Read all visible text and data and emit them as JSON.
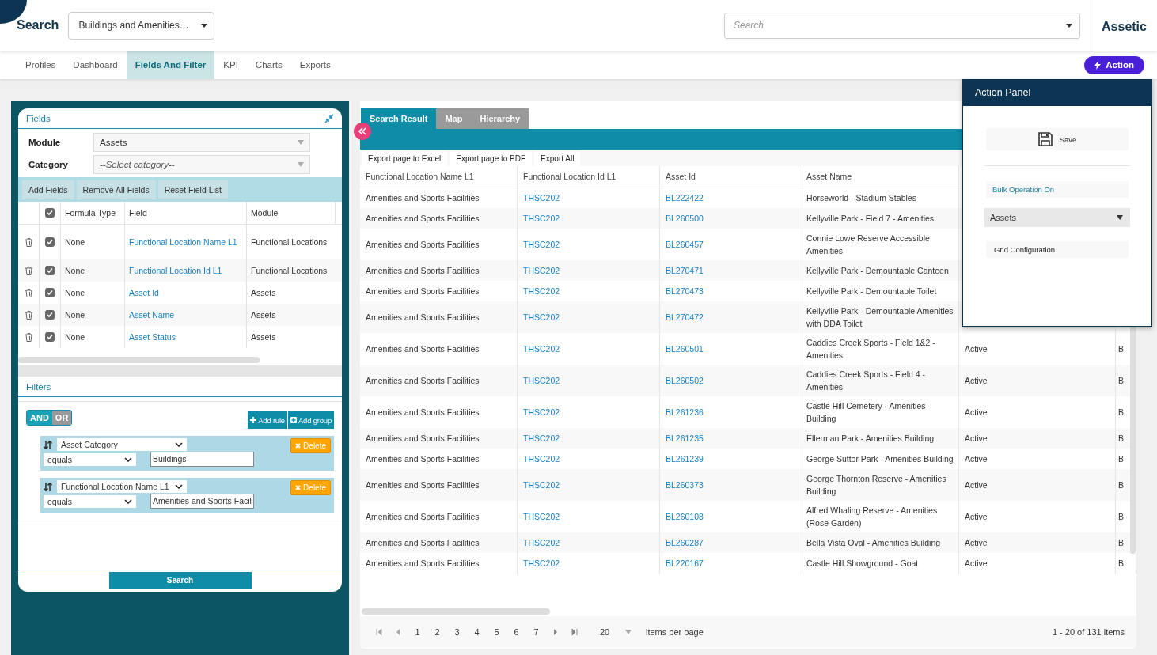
{
  "header": {
    "title": "Search",
    "profile_select": "Buildings and Amenities…",
    "search": {
      "placeholder": "Search"
    },
    "logo": "Assetic"
  },
  "nav_tabs": [
    {
      "label": "Profiles",
      "selected": false
    },
    {
      "label": "Dashboard",
      "selected": false
    },
    {
      "label": "Fields And Filter",
      "selected": true
    },
    {
      "label": "KPI",
      "selected": false
    },
    {
      "label": "Charts",
      "selected": false
    },
    {
      "label": "Exports",
      "selected": false
    }
  ],
  "action_button": "Action",
  "fields_panel": {
    "title": "Fields",
    "module_label": "Module",
    "module_value": "Assets",
    "category_label": "Category",
    "category_placeholder": "--Select category--",
    "buttons": [
      "Add Fields",
      "Remove All Fields",
      "Reset Field List"
    ],
    "columns": [
      "Formula Type",
      "Field",
      "Module"
    ],
    "header_checked": true,
    "rows": [
      {
        "checked": true,
        "formula": "None",
        "field": "Functional Location Name L1",
        "module": "Functional Locations"
      },
      {
        "checked": true,
        "formula": "None",
        "field": "Functional Location Id L1",
        "module": "Functional Locations"
      },
      {
        "checked": true,
        "formula": "None",
        "field": "Asset Id",
        "module": "Assets"
      },
      {
        "checked": true,
        "formula": "None",
        "field": "Asset Name",
        "module": "Assets"
      },
      {
        "checked": true,
        "formula": "None",
        "field": "Asset Status",
        "module": "Assets"
      }
    ]
  },
  "filters_panel": {
    "title": "Filters",
    "conditions": [
      {
        "label": "AND",
        "selected": true
      },
      {
        "label": "OR",
        "selected": false
      }
    ],
    "add_rule": "Add rule",
    "add_group": "Add group",
    "rules": [
      {
        "field": "Asset Category",
        "operator": "equals",
        "value": "Buildings",
        "delete": "Delete"
      },
      {
        "field": "Functional Location Name L1",
        "operator": "equals",
        "value": "Amenities and Sports Facil",
        "delete": "Delete"
      }
    ],
    "search_button": "Search"
  },
  "result_tabs": [
    {
      "label": "Search Result",
      "selected": true
    },
    {
      "label": "Map",
      "selected": false
    },
    {
      "label": "Hierarchy",
      "selected": false
    }
  ],
  "export_buttons": [
    "Export page to Excel",
    "Export page to PDF",
    "Export All"
  ],
  "table": {
    "columns": [
      "Functional Location Name L1",
      "Functional Location Id L1",
      "Asset Id",
      "Asset Name"
    ],
    "rows": [
      {
        "c1": "Amenities and Sports Facilities",
        "c2": "THSC202",
        "c3": "BL222422",
        "c4": "Horseworld - Stadium Stables"
      },
      {
        "c1": "Amenities and Sports Facilities",
        "c2": "THSC202",
        "c3": "BL260500",
        "c4": "Kellyville Park - Field 7 - Amenities"
      },
      {
        "c1": "Amenities and Sports Facilities",
        "c2": "THSC202",
        "c3": "BL260457",
        "c4": "Connie Lowe Reserve Accessible Amenities"
      },
      {
        "c1": "Amenities and Sports Facilities",
        "c2": "THSC202",
        "c3": "BL270471",
        "c4": "Kellyville Park - Demountable Canteen"
      },
      {
        "c1": "Amenities and Sports Facilities",
        "c2": "THSC202",
        "c3": "BL270473",
        "c4": "Kellyville Park - Demountable Toilet"
      },
      {
        "c1": "Amenities and Sports Facilities",
        "c2": "THSC202",
        "c3": "BL270472",
        "c4": "Kellyville Park - Demountable Amenities with DDA Toilet"
      },
      {
        "c1": "Amenities and Sports Facilities",
        "c2": "THSC202",
        "c3": "BL260501",
        "c4": "Caddies Creek Sports - Field 1&2 - Amenities",
        "c5": "Active",
        "c6": "B"
      },
      {
        "c1": "Amenities and Sports Facilities",
        "c2": "THSC202",
        "c3": "BL260502",
        "c4": "Caddies Creek Sports - Field 4 - Amenities",
        "c5": "Active",
        "c6": "B"
      },
      {
        "c1": "Amenities and Sports Facilities",
        "c2": "THSC202",
        "c3": "BL261236",
        "c4": "Castle Hill Cemetery - Amenities Building",
        "c5": "Active",
        "c6": "B"
      },
      {
        "c1": "Amenities and Sports Facilities",
        "c2": "THSC202",
        "c3": "BL261235",
        "c4": "Ellerman Park - Amenities Building",
        "c5": "Active",
        "c6": "B"
      },
      {
        "c1": "Amenities and Sports Facilities",
        "c2": "THSC202",
        "c3": "BL261239",
        "c4": "George Suttor Park - Amenities Building",
        "c5": "Active",
        "c6": "B"
      },
      {
        "c1": "Amenities and Sports Facilities",
        "c2": "THSC202",
        "c3": "BL260373",
        "c4": "George Thornton Reserve - Amenities Building",
        "c5": "Active",
        "c6": "B"
      },
      {
        "c1": "Amenities and Sports Facilities",
        "c2": "THSC202",
        "c3": "BL260108",
        "c4": "Alfred Whaling Reserve - Amenities (Rose Garden)",
        "c5": "Active",
        "c6": "B"
      },
      {
        "c1": "Amenities and Sports Facilities",
        "c2": "THSC202",
        "c3": "BL260287",
        "c4": "Bella Vista Oval - Amenities Building",
        "c5": "Active",
        "c6": "B"
      },
      {
        "c1": "Amenities and Sports Facilities",
        "c2": "THSC202",
        "c3": "BL220167",
        "c4": "Castle Hill Showground - Goat",
        "c5": "Active",
        "c6": "B"
      }
    ]
  },
  "pager": {
    "pages": [
      "1",
      "2",
      "3",
      "4",
      "5",
      "6",
      "7"
    ],
    "page_size": "20",
    "page_size_label": "items per page",
    "summary": "1 - 20 of 131 items"
  },
  "action_panel": {
    "title": "Action Panel",
    "save": "Save",
    "bulk_operation": "Bulk Operation On",
    "module_select": "Assets",
    "grid_configuration": "Grid Configuration"
  }
}
